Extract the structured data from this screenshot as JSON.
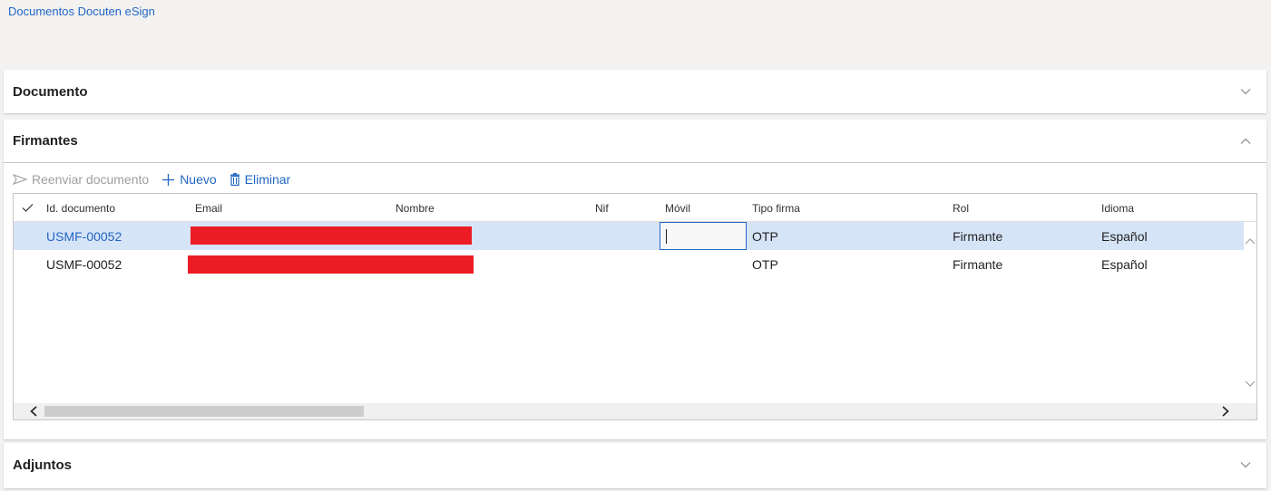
{
  "breadcrumb": "Documentos Docuten eSign",
  "sections": {
    "documento": {
      "title": "Documento",
      "expanded": false
    },
    "firmantes": {
      "title": "Firmantes",
      "expanded": true
    },
    "adjuntos": {
      "title": "Adjuntos",
      "expanded": false
    }
  },
  "toolbar": {
    "resend_label": "Reenviar documento",
    "new_label": "Nuevo",
    "delete_label": "Eliminar"
  },
  "grid": {
    "columns": {
      "id": "Id. documento",
      "email": "Email",
      "nombre": "Nombre",
      "nif": "Nif",
      "movil": "Móvil",
      "tipo": "Tipo firma",
      "rol": "Rol",
      "idioma": "Idioma"
    },
    "rows": [
      {
        "id": "USMF-00052",
        "tipo": "OTP",
        "rol": "Firmante",
        "idioma": "Español",
        "selected": true
      },
      {
        "id": "USMF-00052",
        "tipo": "OTP",
        "rol": "Firmante",
        "idioma": "Español",
        "selected": false
      }
    ]
  },
  "colors": {
    "accent": "#2266c3",
    "selected_row": "#d6e4f8",
    "redaction": "#ec1c24"
  },
  "icons": {
    "resend": "send-icon",
    "new": "plus-icon",
    "delete": "trash-icon",
    "collapse": "chevron-up-icon",
    "expand": "chevron-down-icon"
  }
}
